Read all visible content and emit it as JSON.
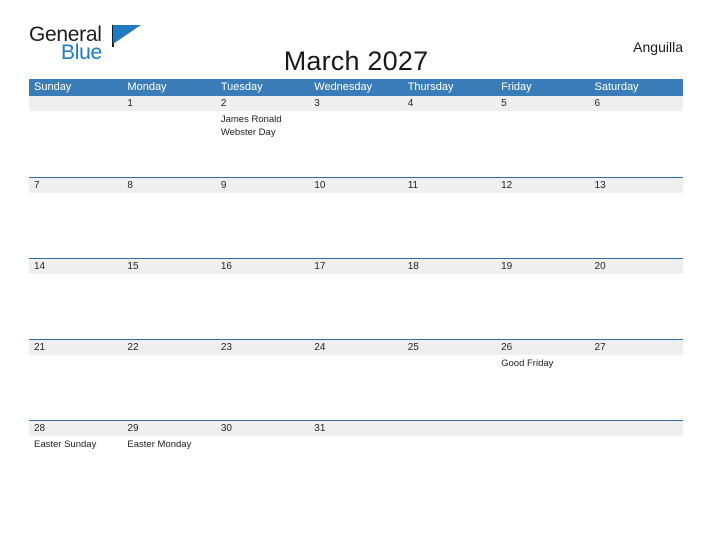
{
  "brand": {
    "name_part1": "General",
    "name_part2": "Blue",
    "flag_icon": "blue-flag-triangle"
  },
  "header": {
    "title": "March 2027",
    "country": "Anguilla"
  },
  "calendar": {
    "month": "March",
    "year": "2027",
    "weekday_headers": [
      "Sunday",
      "Monday",
      "Tuesday",
      "Wednesday",
      "Thursday",
      "Friday",
      "Saturday"
    ],
    "colors": {
      "header_blue": "#3a7cb8",
      "row_divider_blue": "#2f6ea6",
      "date_band_gray": "#efefef",
      "logo_blue": "#1f7ac0",
      "text_dark": "#1a1a1a"
    },
    "weeks": [
      [
        {
          "date": "",
          "events": []
        },
        {
          "date": "1",
          "events": []
        },
        {
          "date": "2",
          "events": [
            "James Ronald Webster Day"
          ]
        },
        {
          "date": "3",
          "events": []
        },
        {
          "date": "4",
          "events": []
        },
        {
          "date": "5",
          "events": []
        },
        {
          "date": "6",
          "events": []
        }
      ],
      [
        {
          "date": "7",
          "events": []
        },
        {
          "date": "8",
          "events": []
        },
        {
          "date": "9",
          "events": []
        },
        {
          "date": "10",
          "events": []
        },
        {
          "date": "11",
          "events": []
        },
        {
          "date": "12",
          "events": []
        },
        {
          "date": "13",
          "events": []
        }
      ],
      [
        {
          "date": "14",
          "events": []
        },
        {
          "date": "15",
          "events": []
        },
        {
          "date": "16",
          "events": []
        },
        {
          "date": "17",
          "events": []
        },
        {
          "date": "18",
          "events": []
        },
        {
          "date": "19",
          "events": []
        },
        {
          "date": "20",
          "events": []
        }
      ],
      [
        {
          "date": "21",
          "events": []
        },
        {
          "date": "22",
          "events": []
        },
        {
          "date": "23",
          "events": []
        },
        {
          "date": "24",
          "events": []
        },
        {
          "date": "25",
          "events": []
        },
        {
          "date": "26",
          "events": [
            "Good Friday"
          ]
        },
        {
          "date": "27",
          "events": []
        }
      ],
      [
        {
          "date": "28",
          "events": [
            "Easter Sunday"
          ]
        },
        {
          "date": "29",
          "events": [
            "Easter Monday"
          ]
        },
        {
          "date": "30",
          "events": []
        },
        {
          "date": "31",
          "events": []
        },
        {
          "date": "",
          "events": []
        },
        {
          "date": "",
          "events": []
        },
        {
          "date": "",
          "events": []
        }
      ]
    ]
  }
}
